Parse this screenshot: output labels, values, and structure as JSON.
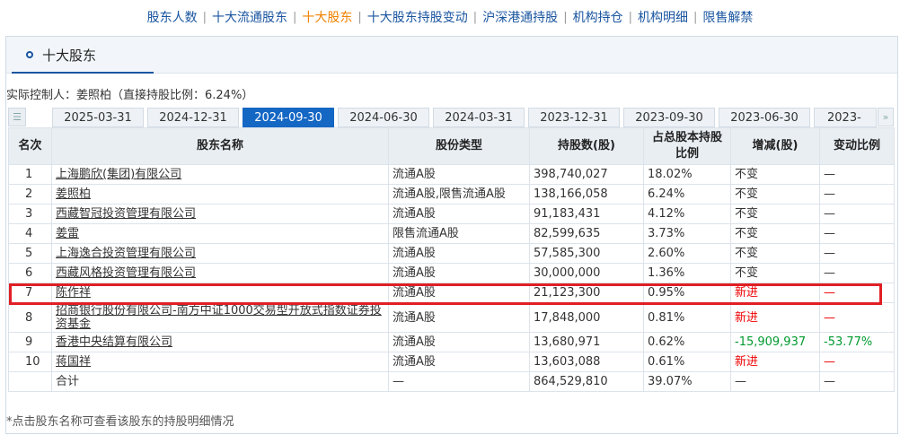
{
  "nav": {
    "items": [
      "股东人数",
      "十大流通股东",
      "十大股东",
      "十大股东持股变动",
      "沪深港通持股",
      "机构持仓",
      "机构明细",
      "限售解禁"
    ],
    "active_index": 2,
    "separator": "|"
  },
  "panel": {
    "title": "十大股东",
    "controller": "实际控制人：姜照柏（直接持股比例：6.24%）",
    "tabs": [
      "2025-03-31",
      "2024-12-31",
      "2024-09-30",
      "2024-06-30",
      "2024-03-31",
      "2023-12-31",
      "2023-09-30",
      "2023-06-30",
      "2023-03-"
    ],
    "active_tab": "2024-09-30",
    "tab_icon": "list-icon",
    "arrow_icon": "double-chevron-right-icon"
  },
  "table": {
    "headers": [
      "名次",
      "股东名称",
      "股份类型",
      "持股数(股)",
      "占总股本持股比例",
      "增减(股)",
      "变动比例"
    ],
    "rows": [
      {
        "rank": "1",
        "name": "上海鹏欣(集团)有限公司",
        "type": "流通A股",
        "shares": "398,740,027",
        "pct": "18.02%",
        "change": "不变",
        "change_pct": "—"
      },
      {
        "rank": "2",
        "name": "姜照柏",
        "type": "流通A股,限售流通A股",
        "shares": "138,166,058",
        "pct": "6.24%",
        "change": "不变",
        "change_pct": "—"
      },
      {
        "rank": "3",
        "name": "西藏智冠投资管理有限公司",
        "type": "流通A股",
        "shares": "91,183,431",
        "pct": "4.12%",
        "change": "不变",
        "change_pct": "—"
      },
      {
        "rank": "4",
        "name": "姜雷",
        "type": "限售流通A股",
        "shares": "82,599,635",
        "pct": "3.73%",
        "change": "不变",
        "change_pct": "—"
      },
      {
        "rank": "5",
        "name": "上海逸合投资管理有限公司",
        "type": "流通A股",
        "shares": "57,585,300",
        "pct": "2.60%",
        "change": "不变",
        "change_pct": "—"
      },
      {
        "rank": "6",
        "name": "西藏风格投资管理有限公司",
        "type": "流通A股",
        "shares": "30,000,000",
        "pct": "1.36%",
        "change": "不变",
        "change_pct": "—"
      },
      {
        "rank": "7",
        "name": "陈作祥",
        "type": "流通A股",
        "shares": "21,123,300",
        "pct": "0.95%",
        "change": "新进",
        "change_pct": "—"
      },
      {
        "rank": "8",
        "name": "招商银行股份有限公司-南方中证1000交易型开放式指数证券投资基金",
        "type": "流通A股",
        "shares": "17,848,000",
        "pct": "0.81%",
        "change": "新进",
        "change_pct": "—"
      },
      {
        "rank": "9",
        "name": "香港中央结算有限公司",
        "type": "流通A股",
        "shares": "13,680,971",
        "pct": "0.62%",
        "change": "-15,909,937",
        "change_pct": "-53.77%"
      },
      {
        "rank": "10",
        "name": "蒋国祥",
        "type": "流通A股",
        "shares": "13,603,088",
        "pct": "0.61%",
        "change": "新进",
        "change_pct": "—"
      }
    ],
    "total": {
      "label": "合计",
      "type": "—",
      "shares": "864,529,810",
      "pct": "39.07%",
      "change": "—",
      "change_pct": "—"
    }
  },
  "footnote": "*点击股东名称可查看该股东的持股明细情况",
  "colors": {
    "link_blue": "#1a55a0",
    "active_orange": "#f08200",
    "tab_active": "#1567c4",
    "increase_red": "#e00000",
    "decrease_green": "#009a2f",
    "highlight_red": "#e01f25"
  }
}
